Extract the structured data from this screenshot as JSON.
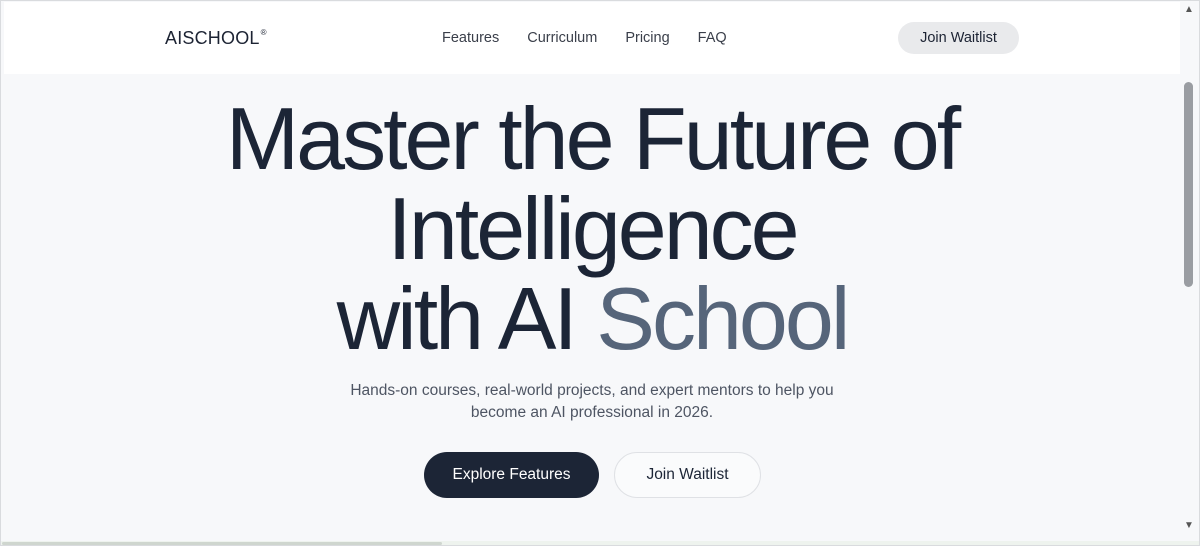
{
  "header": {
    "logo": "AISCHOOL",
    "logo_mark": "®",
    "nav": [
      "Features",
      "Curriculum",
      "Pricing",
      "FAQ"
    ],
    "cta": "Join Waitlist"
  },
  "hero": {
    "title_line1": "Master the Future of",
    "title_line2": "Intelligence",
    "title_line3_a": "with AI",
    "title_line3_b": "School",
    "subtitle_line1": "Hands-on courses, real-world projects, and expert mentors to help you",
    "subtitle_line2": "become an AI professional in 2026.",
    "primary_cta": "Explore Features",
    "secondary_cta": "Join Waitlist"
  },
  "scrollbar": {
    "up_icon": "chevron-up-icon",
    "down_icon": "chevron-down-icon"
  },
  "colors": {
    "text_dark": "#1c2536",
    "accent_text": "#56657a",
    "primary_button": "#1c2536",
    "background": "#f7f8fa"
  }
}
